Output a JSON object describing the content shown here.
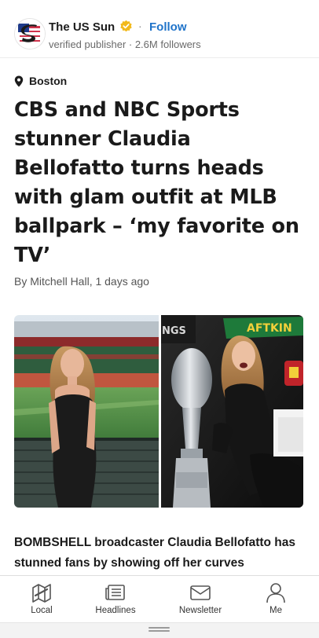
{
  "publisher": {
    "name": "The US Sun",
    "follow_label": "Follow",
    "separator": "·",
    "meta": "verified publisher · 2.6M followers"
  },
  "article": {
    "location": "Boston",
    "headline": "CBS and NBC Sports stunner Claudia Bellofatto turns heads with glam outfit at MLB ballpark – ‘my favorite on TV’",
    "byline": "By Mitchell Hall, 1 days ago",
    "image_overlay_text": {
      "left_logo": "NGS",
      "banner_text": "AFTKIN"
    },
    "lead": "BOMBSHELL broadcaster Claudia Bellofatto has stunned fans by showing off her curves"
  },
  "bottom_nav": [
    {
      "label": "Local",
      "icon": "map-icon"
    },
    {
      "label": "Headlines",
      "icon": "newspaper-icon"
    },
    {
      "label": "Newsletter",
      "icon": "mail-icon"
    },
    {
      "label": "Me",
      "icon": "user-icon"
    }
  ],
  "colors": {
    "accent": "#1f73c9",
    "verified": "#f2b91a"
  }
}
